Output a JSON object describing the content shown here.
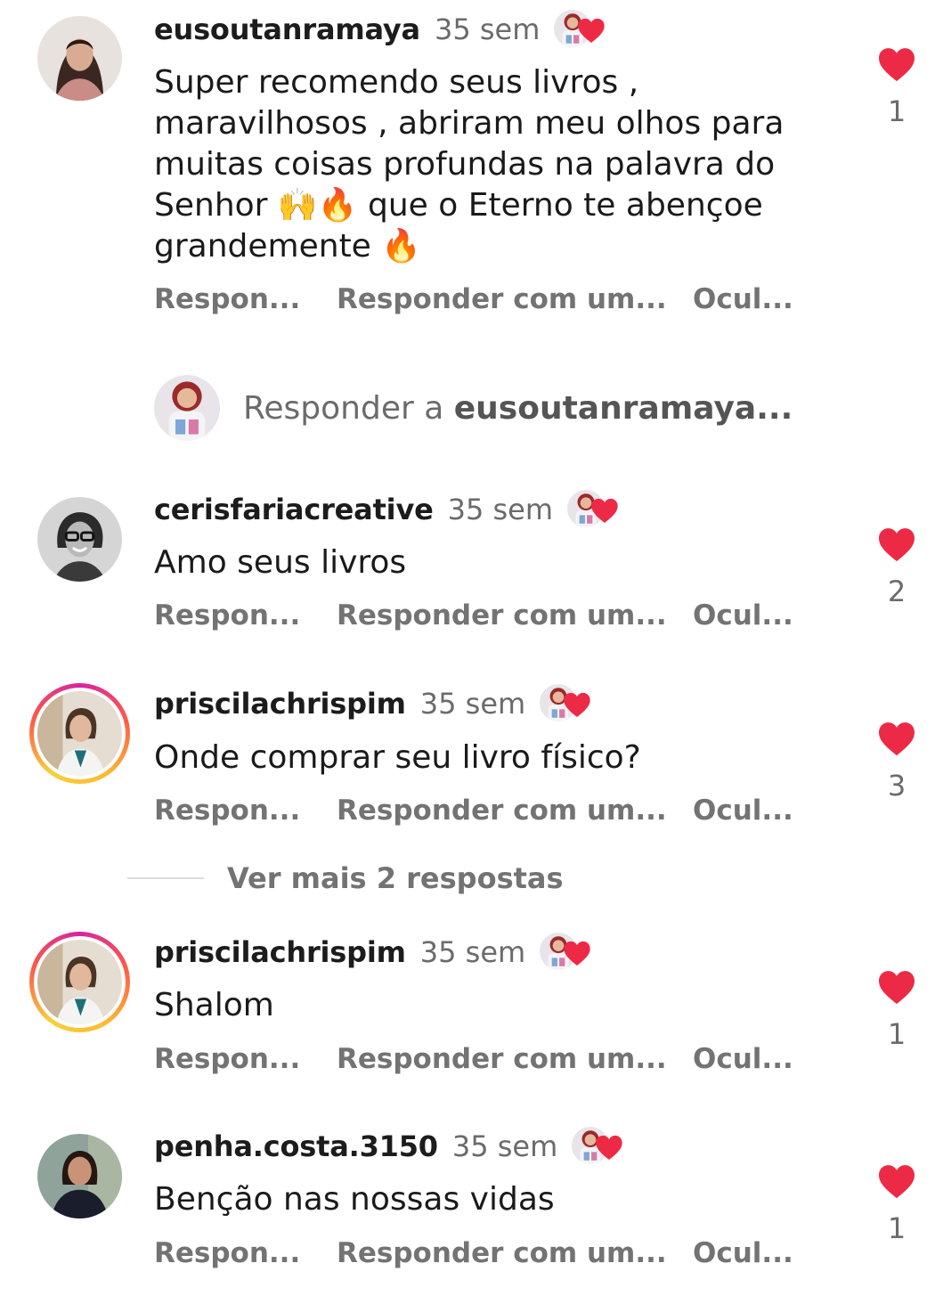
{
  "comments": [
    {
      "username": "eusoutanramaya",
      "time": "35 sem",
      "text": "Super recomendo seus livros , maravilhosos , abriram meu olhos para muitas coisas profundas na palavra do Senhor 🙌🔥 que o Eterno te abençoe grandemente 🔥",
      "likes": "1",
      "actions": [
        "Respon...",
        "Responder com um...",
        "Ocul..."
      ]
    },
    {
      "username": "cerisfariacreative",
      "time": "35 sem",
      "text": "Amo seus livros",
      "likes": "2",
      "actions": [
        "Respon...",
        "Responder com um...",
        "Ocul..."
      ]
    },
    {
      "username": "priscilachrispim",
      "time": "35 sem",
      "text": "Onde comprar seu livro físico?",
      "likes": "3",
      "actions": [
        "Respon...",
        "Responder com um...",
        "Ocul..."
      ]
    },
    {
      "username": "priscilachrispim",
      "time": "35 sem",
      "text": "Shalom",
      "likes": "1",
      "actions": [
        "Respon...",
        "Responder com um...",
        "Ocul..."
      ]
    },
    {
      "username": "penha.costa.3150",
      "time": "35 sem",
      "text": "Benção nas nossas vidas",
      "likes": "1",
      "actions": [
        "Respon...",
        "Responder com um...",
        "Ocul..."
      ]
    }
  ],
  "reply_prompt": {
    "prefix": "Responder a ",
    "target": "eusoutanramaya..."
  },
  "view_more": "Ver mais 2 respostas",
  "icons": {
    "like": "heart-icon",
    "author_loved": "author-liked-icon"
  },
  "colors": {
    "heart": "#ed2a45",
    "secondary_text": "#737373",
    "story_ring": "#d6249f"
  }
}
